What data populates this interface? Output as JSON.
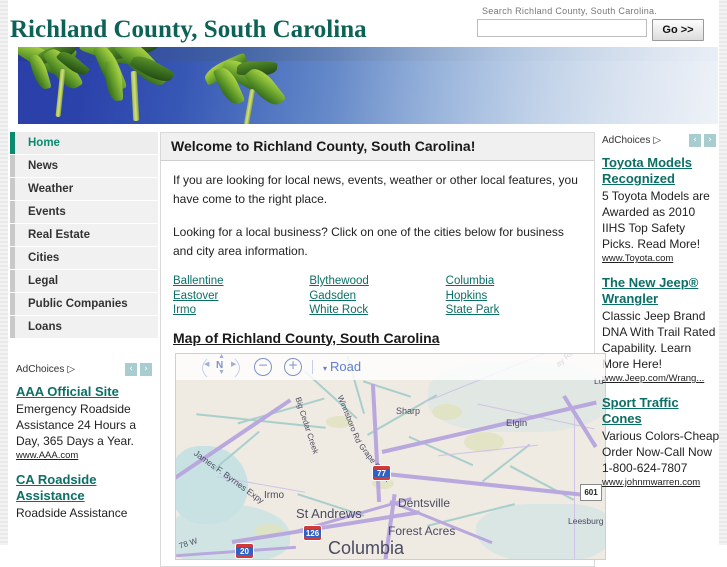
{
  "header": {
    "site_title": "Richland County, South Carolina",
    "search_label": "Search Richland County, South Carolina.",
    "search_value": "",
    "search_placeholder": "",
    "go_label": "Go >>"
  },
  "sidebar": {
    "items": [
      {
        "label": "Home",
        "active": true
      },
      {
        "label": "News",
        "active": false
      },
      {
        "label": "Weather",
        "active": false
      },
      {
        "label": "Events",
        "active": false
      },
      {
        "label": "Real Estate",
        "active": false
      },
      {
        "label": "Cities",
        "active": false
      },
      {
        "label": "Legal",
        "active": false
      },
      {
        "label": "Public Companies",
        "active": false
      },
      {
        "label": "Loans",
        "active": false
      }
    ],
    "ad_block": {
      "adchoices_label": "AdChoices",
      "prev_arrow": "‹",
      "next_arrow": "›",
      "ads": [
        {
          "title": "AAA Official Site",
          "body": "Emergency Roadside Assistance 24 Hours a Day, 365 Days a Year.",
          "url": "www.AAA.com"
        },
        {
          "title": "CA Roadside Assistance",
          "body": "Roadside Assistance",
          "url": ""
        }
      ]
    }
  },
  "main": {
    "welcome_heading": "Welcome to Richland County, South Carolina!",
    "paragraph_1": "If you are looking for local news, events, weather or other local features, you have come to the right place.",
    "paragraph_2": "Looking for a local business? Click on one of the cities below for business and city area information.",
    "cities": [
      "Ballentine",
      "Blythewood",
      "Columbia",
      "Eastover",
      "Gadsden",
      "Hopkins",
      "Irmo",
      "White Rock",
      "State Park"
    ],
    "map_heading": "Map of Richland County, South Carolina",
    "map": {
      "compass_letter": "N",
      "zoom_out": "−",
      "zoom_in": "+",
      "map_type": "Road",
      "caret": "▾",
      "place_labels": [
        "Sharp",
        "Elgin",
        "Irmo",
        "Dentsville",
        "St Andrews",
        "Forest Acres",
        "Columbia",
        "Leesburg",
        "Lu"
      ],
      "road_labels": [
        "Big Cedar Creek",
        "Winnsboro Rd",
        "James F. Byrnes Expy",
        "Grape Creek",
        "ay Rd",
        "78 W"
      ],
      "highway_shields": [
        "77",
        "126",
        "20",
        "601"
      ]
    }
  },
  "right_sidebar": {
    "adchoices_label": "AdChoices",
    "prev_arrow": "‹",
    "next_arrow": "›",
    "ads": [
      {
        "title": "Toyota Models Recognized",
        "body": "5 Toyota Models are Awarded as 2010 IIHS Top Safety Picks. Read More!",
        "url": "www.Toyota.com"
      },
      {
        "title": "The New Jeep® Wrangler",
        "body": "Classic Jeep Brand DNA With Trail Rated Capability. Learn More Here!",
        "url": "www.Jeep.com/Wrang..."
      },
      {
        "title": "Sport Traffic Cones",
        "body": "Various Colors-Cheap Order Now-Call Now 1-800-624-7807",
        "url": "www.johnmwarren.com"
      }
    ]
  },
  "colors": {
    "brand_teal": "#0d6258",
    "link_teal": "#0b6f66",
    "active_nav": "#0b8a70",
    "map_road": "#b9a8dd",
    "map_water": "#c8e2e4"
  }
}
